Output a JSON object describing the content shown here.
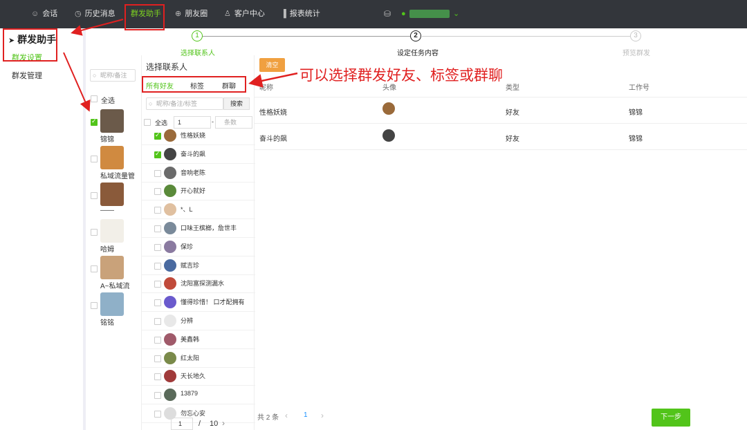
{
  "nav": {
    "items": [
      {
        "label": "会话",
        "icon": "chat-icon",
        "glyph": "☺"
      },
      {
        "label": "历史消息",
        "icon": "clock-icon",
        "glyph": "◷"
      },
      {
        "label": "群发助手",
        "icon": "",
        "glyph": ""
      },
      {
        "label": "朋友圈",
        "icon": "globe-icon",
        "glyph": "⊕"
      },
      {
        "label": "客户中心",
        "icon": "user-icon",
        "glyph": "♙"
      },
      {
        "label": "报表统计",
        "icon": "bar-chart-icon",
        "glyph": "▐"
      }
    ],
    "active_index": 2,
    "accent": "#7ed321"
  },
  "sidebar": {
    "title": "群发助手",
    "items": [
      "群发设置",
      "群发管理"
    ],
    "active_index": 0
  },
  "steps": [
    {
      "num": "1",
      "label": "选择联系人",
      "state": "done"
    },
    {
      "num": "2",
      "label": "设定任务内容",
      "state": "current"
    },
    {
      "num": "3",
      "label": "预览群发",
      "state": "todo"
    }
  ],
  "candidates": {
    "search_placeholder": "昵称/备注",
    "select_all": "全选",
    "items": [
      {
        "name": "锦锦",
        "checked": true,
        "color": "#6b5a4a"
      },
      {
        "name": "私域流量管",
        "checked": false,
        "color": "#d08a40"
      },
      {
        "name": "——",
        "checked": false,
        "color": "#8a5a3a"
      },
      {
        "name": "哈姆",
        "checked": false,
        "color": "#f2efe8"
      },
      {
        "name": "A~私域流",
        "checked": false,
        "color": "#c9a27a"
      },
      {
        "name": "铭铭",
        "checked": false,
        "color": "#8fb0c8"
      }
    ]
  },
  "contacts": {
    "title": "选择联系人",
    "tabs": [
      "所有好友",
      "标签",
      "群聊"
    ],
    "active_tab": 0,
    "search_placeholder": "昵称/备注/标签",
    "search_button": "搜索",
    "select_all": "全选",
    "range_from": "1",
    "range_sep": "-",
    "range_to_placeholder": "条数",
    "items": [
      {
        "name": "性格妖娆",
        "checked": true,
        "color": "#9a6a3a"
      },
      {
        "name": "奋斗的飙",
        "checked": true,
        "color": "#444444"
      },
      {
        "name": "音响老陈",
        "checked": false,
        "color": "#6a6a6a"
      },
      {
        "name": "开心就好",
        "checked": false,
        "color": "#5a8a3a"
      },
      {
        "name": "*、L",
        "checked": false,
        "color": "#e0c0a0"
      },
      {
        "name": "口味王槟榔，詹世丰",
        "checked": false,
        "color": "#7a8a9a"
      },
      {
        "name": "保珍",
        "checked": false,
        "color": "#8a7aa0"
      },
      {
        "name": "赋吉珍",
        "checked": false,
        "color": "#4a6aa0"
      },
      {
        "name": "沈阳富探测漏水",
        "checked": false,
        "color": "#c04a3a"
      },
      {
        "name": "懂得珍惜！ 口才配拥有",
        "checked": false,
        "color": "#6a5acd"
      },
      {
        "name": "分辨",
        "checked": false,
        "color": "#e8e8e8"
      },
      {
        "name": "美鑫韩",
        "checked": false,
        "color": "#a05a6a"
      },
      {
        "name": "红太阳",
        "checked": false,
        "color": "#7a8a4a"
      },
      {
        "name": "天长地久",
        "checked": false,
        "color": "#a03a3a"
      },
      {
        "name": "13879",
        "checked": false,
        "color": "#5a6a5a"
      },
      {
        "name": "勿忘心安",
        "checked": false,
        "color": "#dddddd"
      }
    ],
    "pager_current": "1",
    "pager_sep": "/",
    "pager_total": "10",
    "pager_next": "›"
  },
  "table": {
    "clear_button": "清空",
    "headers": [
      "昵称",
      "头像",
      "类型",
      "工作号"
    ],
    "rows": [
      {
        "nickname": "性格妖娆",
        "type": "好友",
        "account": "锦锦",
        "color": "#9a6a3a"
      },
      {
        "nickname": "奋斗的飙",
        "type": "好友",
        "account": "锦锦",
        "color": "#444444"
      }
    ],
    "total_text": "共 2 条",
    "prev": "‹",
    "page": "1",
    "next": "›",
    "next_button": "下一步"
  },
  "annotation": "可以选择群发好友、标签或群聊",
  "colors": {
    "green": "#52c41a",
    "red": "#e02020",
    "orange": "#f0a040",
    "nav_bg": "#33363b"
  }
}
